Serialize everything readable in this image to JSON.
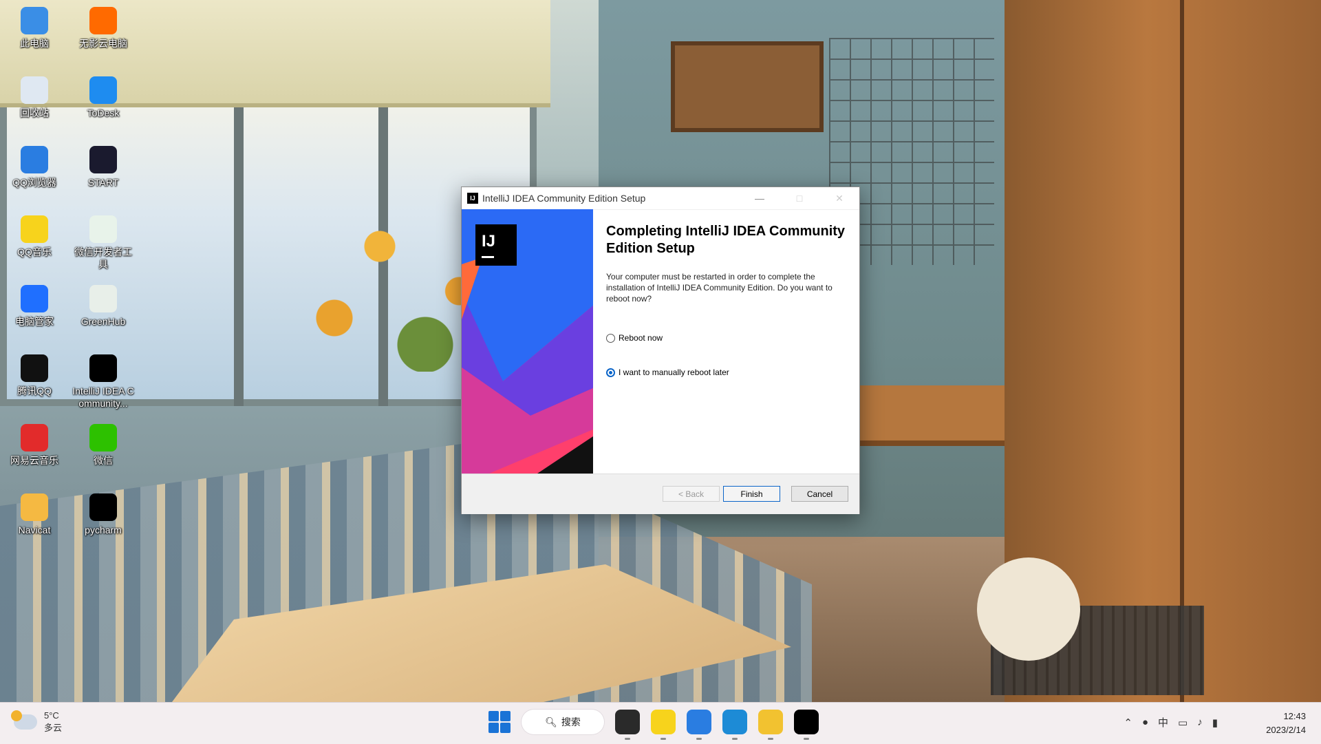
{
  "desktop_icons": [
    {
      "label": "此电脑",
      "icon": "computer-icon",
      "color": "#3a8ee6"
    },
    {
      "label": "无影云电脑",
      "icon": "cloud-pc-icon",
      "color": "#ff6a00"
    },
    {
      "label": "回收站",
      "icon": "recycle-bin-icon",
      "color": "#dfe8f2"
    },
    {
      "label": "ToDesk",
      "icon": "todesk-icon",
      "color": "#1e8cf0"
    },
    {
      "label": "QQ浏览器",
      "icon": "qq-browser-icon",
      "color": "#2a7de1"
    },
    {
      "label": "START",
      "icon": "start-app-icon",
      "color": "#1a1a2e"
    },
    {
      "label": "QQ音乐",
      "icon": "qq-music-icon",
      "color": "#f7d31c"
    },
    {
      "label": "微信开发者工具",
      "icon": "wechat-devtools-icon",
      "color": "#e8f3ea"
    },
    {
      "label": "电脑管家",
      "icon": "pc-manager-icon",
      "color": "#1f6fff"
    },
    {
      "label": "GreenHub",
      "icon": "greenhub-icon",
      "color": "#e8efe9"
    },
    {
      "label": "腾讯QQ",
      "icon": "qq-icon",
      "color": "#111111"
    },
    {
      "label": "IntelliJ IDEA Community...",
      "icon": "intellij-icon",
      "color": "#000000"
    },
    {
      "label": "网易云音乐",
      "icon": "netease-music-icon",
      "color": "#e22b2b"
    },
    {
      "label": "微信",
      "icon": "wechat-icon",
      "color": "#2dc100"
    },
    {
      "label": "Navicat",
      "icon": "navicat-icon",
      "color": "#f5b942"
    },
    {
      "label": "pycharm",
      "icon": "pycharm-icon",
      "color": "#000000"
    }
  ],
  "dialog": {
    "title": "IntelliJ IDEA Community Edition Setup",
    "banner_logo": "IJ",
    "heading": "Completing IntelliJ IDEA Community Edition Setup",
    "description": "Your computer must be restarted in order to complete the installation of IntelliJ IDEA Community Edition. Do you want to reboot now?",
    "options": [
      {
        "label": "Reboot now",
        "checked": false
      },
      {
        "label": "I want to manually reboot later",
        "checked": true
      }
    ],
    "buttons": {
      "back": "< Back",
      "finish": "Finish",
      "cancel": "Cancel"
    }
  },
  "taskbar": {
    "weather_temp": "5°C",
    "weather_desc": "多云",
    "search_label": "搜索",
    "apps": [
      {
        "icon": "task-view-icon",
        "color": "#2a2a2a"
      },
      {
        "icon": "qq-music-icon",
        "color": "#f7d31c"
      },
      {
        "icon": "qq-browser-icon",
        "color": "#2a7de1"
      },
      {
        "icon": "edge-icon",
        "color": "#1d8bd6"
      },
      {
        "icon": "file-explorer-icon",
        "color": "#f2c230"
      },
      {
        "icon": "intellij-installer-icon",
        "color": "#000000"
      }
    ],
    "ime": "中",
    "time": "12:43",
    "date": "2023/2/14"
  }
}
